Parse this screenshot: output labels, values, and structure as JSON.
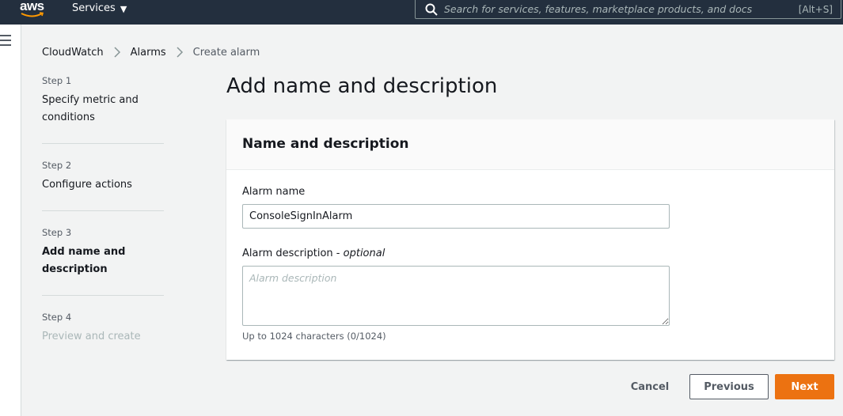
{
  "nav": {
    "logo_text": "aws",
    "services_label": "Services",
    "search_placeholder": "Search for services, features, marketplace products, and docs",
    "search_shortcut": "[Alt+S]"
  },
  "breadcrumb": {
    "items": [
      "CloudWatch",
      "Alarms",
      "Create alarm"
    ]
  },
  "steps": [
    {
      "number": "Step 1",
      "label": "Specify metric and conditions",
      "state": "link"
    },
    {
      "number": "Step 2",
      "label": "Configure actions",
      "state": "link"
    },
    {
      "number": "Step 3",
      "label": "Add name and description",
      "state": "active"
    },
    {
      "number": "Step 4",
      "label": "Preview and create",
      "state": "disabled"
    }
  ],
  "page": {
    "title": "Add name and description"
  },
  "form": {
    "container_title": "Name and description",
    "alarm_name_label": "Alarm name",
    "alarm_name_value": "ConsoleSignInAlarm",
    "alarm_description_label": "Alarm description",
    "alarm_description_optional": "optional",
    "alarm_description_placeholder": "Alarm description",
    "alarm_description_value": "",
    "alarm_description_constraint": "Up to 1024 characters (0/1024)"
  },
  "actions": {
    "cancel_label": "Cancel",
    "previous_label": "Previous",
    "next_label": "Next"
  },
  "colors": {
    "nav_bg": "#232f3e",
    "primary": "#ec7211",
    "page_bg": "#f2f3f3"
  }
}
